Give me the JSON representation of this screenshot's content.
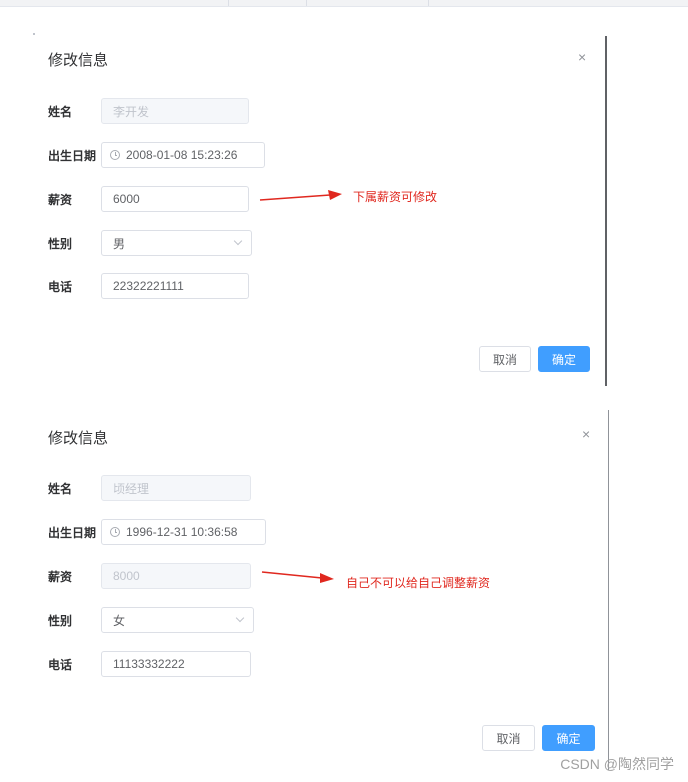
{
  "dialogs": [
    {
      "title": "修改信息",
      "close_glyph": "×",
      "fields": {
        "name_label": "姓名",
        "name_value": "李开发",
        "birth_label": "出生日期",
        "birth_value": "2008-01-08 15:23:26",
        "salary_label": "薪资",
        "salary_value": "6000",
        "gender_label": "性别",
        "gender_value": "男",
        "phone_label": "电话",
        "phone_value": "22322221111"
      },
      "salary_editable": true,
      "annotation": "下属薪资可修改",
      "cancel_label": "取消",
      "confirm_label": "确定"
    },
    {
      "title": "修改信息",
      "close_glyph": "×",
      "fields": {
        "name_label": "姓名",
        "name_value": "顷经理",
        "birth_label": "出生日期",
        "birth_value": "1996-12-31 10:36:58",
        "salary_label": "薪资",
        "salary_value": "8000",
        "gender_label": "性别",
        "gender_value": "女",
        "phone_label": "电话",
        "phone_value": "11133332222"
      },
      "salary_editable": false,
      "annotation": "自己不可以给自己调整薪资",
      "cancel_label": "取消",
      "confirm_label": "确定"
    }
  ],
  "colors": {
    "primary": "#409eff",
    "annotation": "#e0281f",
    "disabled_bg": "#f5f7fa"
  },
  "icons": [
    "clock-icon",
    "chevron-down-icon",
    "close-icon",
    "arrow"
  ],
  "watermark": "CSDN @陶然同学"
}
